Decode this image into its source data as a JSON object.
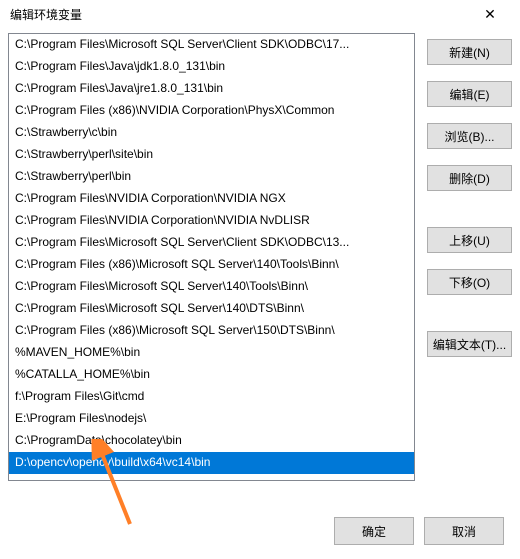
{
  "title": "编辑环境变量",
  "list": {
    "items": [
      "C:\\Program Files\\Microsoft SQL Server\\Client SDK\\ODBC\\17...",
      "C:\\Program Files\\Java\\jdk1.8.0_131\\bin",
      "C:\\Program Files\\Java\\jre1.8.0_131\\bin",
      "C:\\Program Files (x86)\\NVIDIA Corporation\\PhysX\\Common",
      "C:\\Strawberry\\c\\bin",
      "C:\\Strawberry\\perl\\site\\bin",
      "C:\\Strawberry\\perl\\bin",
      "C:\\Program Files\\NVIDIA Corporation\\NVIDIA NGX",
      "C:\\Program Files\\NVIDIA Corporation\\NVIDIA NvDLISR",
      "C:\\Program Files\\Microsoft SQL Server\\Client SDK\\ODBC\\13...",
      "C:\\Program Files (x86)\\Microsoft SQL Server\\140\\Tools\\Binn\\",
      "C:\\Program Files\\Microsoft SQL Server\\140\\Tools\\Binn\\",
      "C:\\Program Files\\Microsoft SQL Server\\140\\DTS\\Binn\\",
      "C:\\Program Files (x86)\\Microsoft SQL Server\\150\\DTS\\Binn\\",
      "%MAVEN_HOME%\\bin",
      "%CATALLA_HOME%\\bin",
      "f:\\Program Files\\Git\\cmd",
      "E:\\Program Files\\nodejs\\",
      "C:\\ProgramData\\chocolatey\\bin",
      "D:\\opencv\\opencv\\build\\x64\\vc14\\bin"
    ],
    "selected_index": 19
  },
  "buttons": {
    "new": "新建(N)",
    "edit": "编辑(E)",
    "browse": "浏览(B)...",
    "delete": "删除(D)",
    "move_up": "上移(U)",
    "move_down": "下移(O)",
    "edit_text": "编辑文本(T)...",
    "ok": "确定",
    "cancel": "取消"
  }
}
